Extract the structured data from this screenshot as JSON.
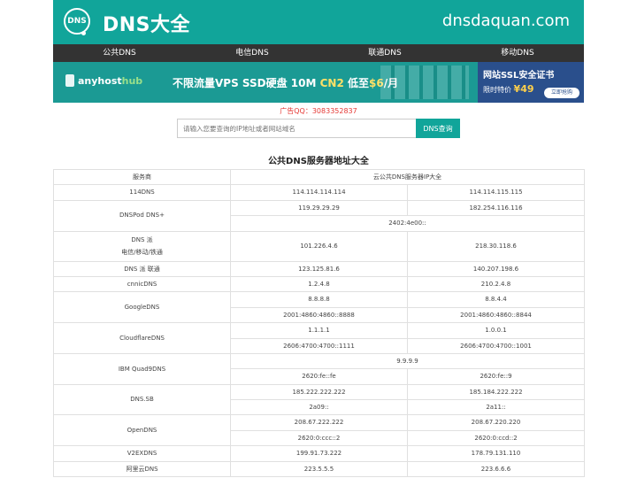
{
  "header": {
    "logo_text": "DNS",
    "brand": "DNS大全",
    "domain": "dnsdaquan.com"
  },
  "nav": {
    "items": [
      "公共DNS",
      "电信DNS",
      "联通DNS",
      "移动DNS"
    ]
  },
  "banner": {
    "hub_name_a": "anyhost",
    "hub_name_b": "hub",
    "slogan_a": "不限流量VPS SSD硬盘 10M ",
    "slogan_b": "CN2",
    "slogan_c": " 低至",
    "slogan_price": "$6",
    "slogan_d": "/月",
    "ssl_title": "网站SSL安全证书",
    "ssl_price_label": "限时特价",
    "ssl_price": "¥49",
    "ssl_button": "立即抢购"
  },
  "ad_qq": "广告QQ：3083352837",
  "search": {
    "placeholder": "请输入您要查询的IP地址或者网站域名",
    "button": "DNS查询"
  },
  "table": {
    "title": "公共DNS服务器地址大全",
    "header_provider": "服务商",
    "header_ip": "云公共DNS服务器IP大全",
    "rows": [
      {
        "name": "114DNS",
        "ip1": "114.114.114.114",
        "ip2": "114.114.115.115"
      },
      {
        "name": "DNSPod DNS+",
        "ip1": "119.29.29.29",
        "ip2": "182.254.116.116",
        "ipv6": "2402:4e00::"
      },
      {
        "name_line1": "DNS 派",
        "name_line2": "电信/移动/铁通",
        "ip1": "101.226.4.6",
        "ip2": "218.30.118.6"
      },
      {
        "name": "DNS 派 联通",
        "ip1": "123.125.81.6",
        "ip2": "140.207.198.6"
      },
      {
        "name": "cnnicDNS",
        "ip1": "1.2.4.8",
        "ip2": "210.2.4.8"
      },
      {
        "name": "GoogleDNS",
        "ip1": "8.8.8.8",
        "ip2": "8.8.4.4",
        "ip3": "2001:4860:4860::8888",
        "ip4": "2001:4860:4860::8844"
      },
      {
        "name": "CloudflareDNS",
        "ip1": "1.1.1.1",
        "ip2": "1.0.0.1",
        "ip3": "2606:4700:4700::1111",
        "ip4": "2606:4700:4700::1001"
      },
      {
        "name": "IBM Quad9DNS",
        "ip_full": "9.9.9.9",
        "ip3": "2620:fe::fe",
        "ip4": "2620:fe::9"
      },
      {
        "name": "DNS.SB",
        "ip1": "185.222.222.222",
        "ip2": "185.184.222.222",
        "ip3": "2a09::",
        "ip4": "2a11::"
      },
      {
        "name": "OpenDNS",
        "ip1": "208.67.222.222",
        "ip2": "208.67.220.220",
        "ip3": "2620:0:ccc::2",
        "ip4": "2620:0:ccd::2"
      },
      {
        "name": "V2EXDNS",
        "ip1": "199.91.73.222",
        "ip2": "178.79.131.110"
      },
      {
        "name": "阿里云DNS",
        "ip1": "223.5.5.5",
        "ip2": "223.6.6.6"
      }
    ]
  }
}
